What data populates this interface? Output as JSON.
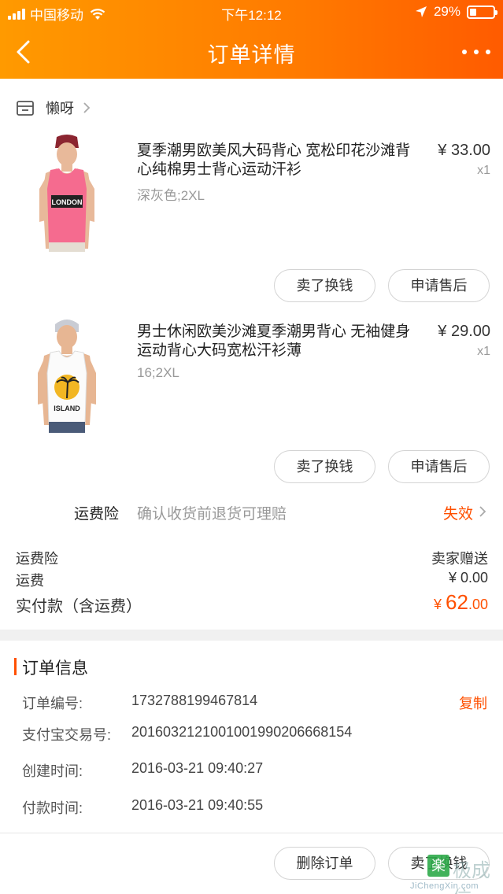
{
  "status_bar": {
    "carrier": "中国移动",
    "time": "下午12:12",
    "battery_percent": "29%",
    "battery_level": 0.29
  },
  "nav": {
    "title": "订单详情",
    "back_icon": "chevron-left-icon",
    "more_icon": "more-dots-icon"
  },
  "shop": {
    "name": "懒呀",
    "icon": "store-icon"
  },
  "products": [
    {
      "name": "夏季潮男欧美风大码背心 宽松印花沙滩背心纯棉男士背心运动汗衫",
      "spec": "深灰色;2XL",
      "price": "¥ 33.00",
      "qty": "x1",
      "shirt_text": "LONDON",
      "shirt_color": "#f56b8f",
      "buttons": [
        "卖了换钱",
        "申请售后"
      ]
    },
    {
      "name": "男士休闲欧美沙滩夏季潮男背心 无袖健身运动背心大码宽松汗衫薄",
      "spec": "16;2XL",
      "price": "¥ 29.00",
      "qty": "x1",
      "shirt_text": "ISLAND",
      "shirt_color": "#ffffff",
      "buttons": [
        "卖了换钱",
        "申请售后"
      ]
    }
  ],
  "insurance": {
    "label": "运费险",
    "desc": "确认收货前退货可理赔",
    "status": "失效"
  },
  "summary": {
    "insurance_label": "运费险",
    "insurance_value": "卖家赠送",
    "freight_label": "运费",
    "freight_value": "¥ 0.00",
    "paid_label": "实付款（含运费）",
    "paid_yen": "¥ ",
    "paid_int": "62",
    "paid_dec": ".00"
  },
  "order_info": {
    "title": "订单信息",
    "rows": [
      {
        "label": "订单编号:",
        "value": "1732788199467814"
      },
      {
        "label": "支付宝交易号:",
        "value": "2016032121001001990206668154"
      },
      {
        "label": "创建时间:",
        "value": "2016-03-21 09:40:27"
      },
      {
        "label": "付款时间:",
        "value": "2016-03-21 09:40:55"
      }
    ],
    "copy_label": "复制"
  },
  "bottom_buttons": {
    "delete": "删除订单",
    "sell": "卖了换钱"
  },
  "watermark": {
    "logo": "楽",
    "text": "极成信",
    "url": "JiChengXin.com"
  },
  "colors": {
    "accent": "#ff5000",
    "header_start": "#ff9a00",
    "header_end": "#ff5b00"
  }
}
